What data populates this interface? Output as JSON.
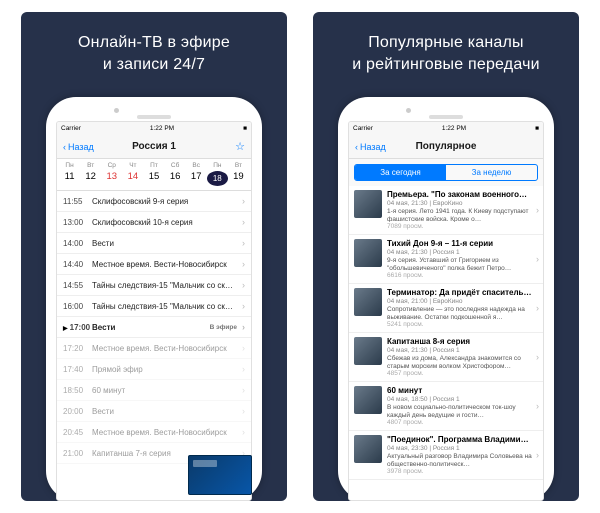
{
  "left": {
    "tagline1": "Онлайн-ТВ в эфире",
    "tagline2": "и записи 24/7",
    "status": {
      "carrier": "Carrier",
      "wifi": "ᯤ",
      "time": "1:22 PM",
      "batt": "■"
    },
    "nav": {
      "back": "Назад",
      "title": "Россия 1",
      "star": "☆"
    },
    "cal": {
      "heads": [
        "Пн",
        "Вт",
        "Ср",
        "Чт",
        "Пт",
        "Сб",
        "Вс",
        "Пн",
        "Вт"
      ],
      "days": [
        "11",
        "12",
        "13",
        "14",
        "15",
        "16",
        "17",
        "18",
        "19"
      ],
      "redIdx": [
        2,
        3
      ],
      "todayIdx": 7
    },
    "rows": [
      {
        "time": "11:55",
        "title": "Склифосовский 9-я серия",
        "state": ""
      },
      {
        "time": "13:00",
        "title": "Склифосовский 10-я серия",
        "state": ""
      },
      {
        "time": "14:00",
        "title": "Вести",
        "state": ""
      },
      {
        "time": "14:40",
        "title": "Местное время. Вести-Новосибирск",
        "state": ""
      },
      {
        "time": "14:55",
        "title": "Тайны следствия-15 \"Мальчик со скри…",
        "state": ""
      },
      {
        "time": "16:00",
        "title": "Тайны следствия-15 \"Мальчик со скри…",
        "state": ""
      },
      {
        "time": "17:00",
        "title": "Вести",
        "state": "current",
        "badge": "В эфире"
      },
      {
        "time": "17:20",
        "title": "Местное время. Вести-Новосибирск",
        "state": "faded"
      },
      {
        "time": "17:40",
        "title": "Прямой эфир",
        "state": "faded"
      },
      {
        "time": "18:50",
        "title": "60 минут",
        "state": "faded"
      },
      {
        "time": "20:00",
        "title": "Вести",
        "state": "faded"
      },
      {
        "time": "20:45",
        "title": "Местное время. Вести-Новосибирск",
        "state": "faded"
      },
      {
        "time": "21:00",
        "title": "Капитанша 7-я серия",
        "state": "faded"
      }
    ]
  },
  "right": {
    "tagline1": "Популярные каналы",
    "tagline2": "и рейтинговые передачи",
    "status": {
      "carrier": "Carrier",
      "wifi": "ᯤ",
      "time": "1:22 PM",
      "batt": "■"
    },
    "nav": {
      "back": "Назад",
      "title": "Популярное"
    },
    "seg": {
      "today": "За сегодня",
      "week": "За неделю"
    },
    "items": [
      {
        "t": "Премьера. \"По законам военного…",
        "m": "04 мая, 21:30 | ЕвроКино",
        "d": "1-я серия. Лето 1941 года. К Киеву подступают фашистские войска. Кроме о…",
        "v": "7089 просм."
      },
      {
        "t": "Тихий Дон 9-я – 11-я серии",
        "m": "04 мая, 21:30 | Россия 1",
        "d": "9-я серия. Уставший от Григорием из \"обольшевиченого\" полка бежит Петро…",
        "v": "6616 просм."
      },
      {
        "t": "Терминатор: Да придёт спаситель…",
        "m": "04 мая, 21:00 | ЕвроКино",
        "d": "Сопротивление — это последняя надежда на выживание. Остатки подкошенной я…",
        "v": "5241 просм."
      },
      {
        "t": "Капитанша 8-я серия",
        "m": "04 мая, 21:30 | Россия 1",
        "d": "Сбежав из дома, Александра знакомится со старым морским волком Христофором…",
        "v": "4857 просм."
      },
      {
        "t": "60 минут",
        "m": "04 мая, 18:50 | Россия 1",
        "d": "В новом социально-политическом ток-шоу каждый день ведущие и гости…",
        "v": "4807 просм."
      },
      {
        "t": "\"Поединок\". Программа Владими…",
        "m": "04 мая, 23:30 | Россия 1",
        "d": "Актуальный разговор Владимира Соловьева на общественно-политическ…",
        "v": "3978 просм."
      }
    ]
  }
}
